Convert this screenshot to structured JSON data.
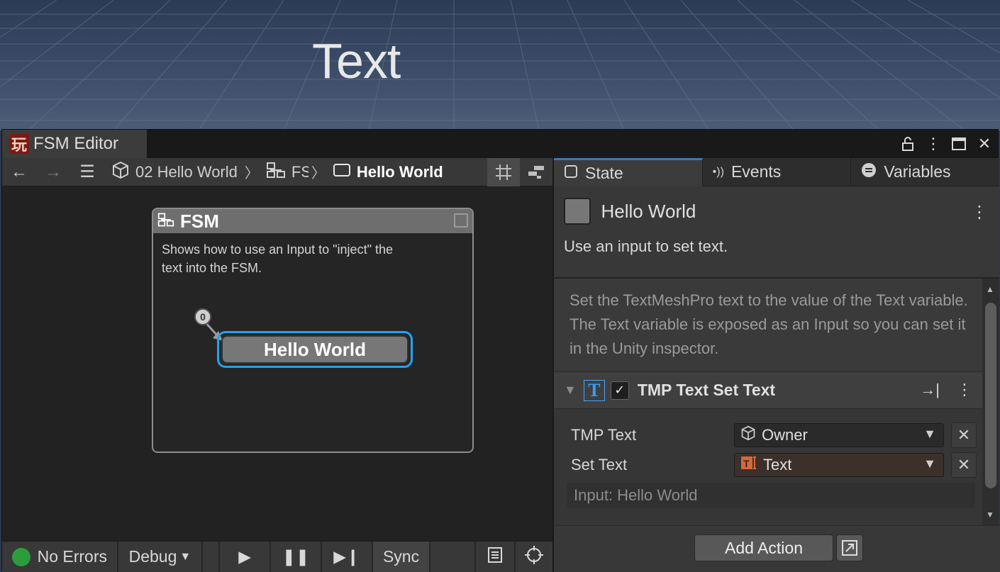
{
  "scene": {
    "label": "Text"
  },
  "window": {
    "title": "FSM Editor",
    "logo_glyph": "玩",
    "icons": [
      "lock-icon",
      "kebab-icon",
      "maximize-icon",
      "close-icon"
    ]
  },
  "toolbar": {
    "breadcrumbs": [
      {
        "icon": "cube-icon",
        "label": "02 Hello World"
      },
      {
        "icon": "hierarchy-icon",
        "label": "FS"
      },
      {
        "icon": "state-icon",
        "label": "Hello World"
      }
    ],
    "right_icons": [
      "grid-icon",
      "layout-icon"
    ]
  },
  "graph": {
    "fsm_title": "FSM",
    "fsm_description": "Shows how to use an Input to \"inject\" the text into the FSM.",
    "start_marker": "0",
    "state_name": "Hello World",
    "accent_color": "#1da4f2"
  },
  "statusbar": {
    "status": "No Errors",
    "status_color": "#2c9c3c",
    "debug": "Debug",
    "sync": "Sync"
  },
  "inspector": {
    "tabs": [
      {
        "icon": "□",
        "label": "State"
      },
      {
        "icon": "•))",
        "label": "Events"
      },
      {
        "icon": "≡",
        "label": "Variables"
      }
    ],
    "state_name": "Hello World",
    "state_description": "Use an input to set text.",
    "comment": "Set the TextMeshPro text to the value of the Text variable. The Text variable is exposed as an Input so you can set it in the Unity inspector.",
    "action": {
      "title": "TMP Text Set Text",
      "enabled": true,
      "params": [
        {
          "label": "TMP Text",
          "value": "Owner",
          "icon": "cube-icon"
        },
        {
          "label": "Set Text",
          "value": "Text",
          "icon": "text-variable-icon"
        }
      ],
      "input_hint": "Input: Hello World"
    },
    "add_action_label": "Add Action"
  }
}
